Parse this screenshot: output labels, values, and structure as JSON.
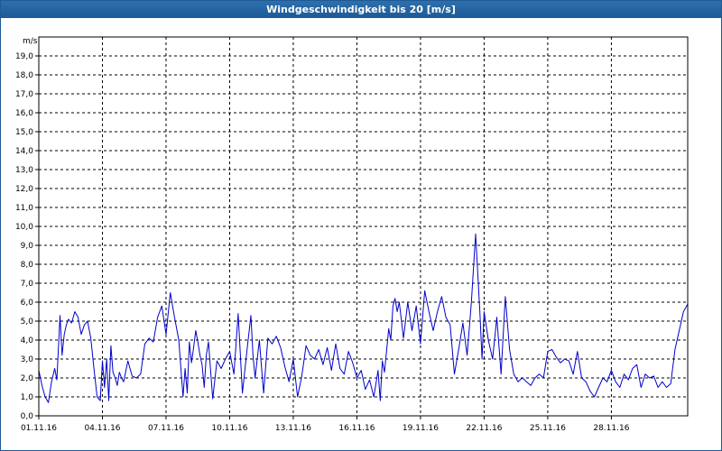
{
  "window": {
    "title": "Windgeschwindigkeit bis 20 [m/s]"
  },
  "chart_data": {
    "type": "line",
    "title": "Windgeschwindigkeit bis 20 [m/s]",
    "ylabel": "m/s",
    "xlabel": "",
    "ylim": [
      0,
      20
    ],
    "yticks": [
      "0,0",
      "1,0",
      "2,0",
      "3,0",
      "4,0",
      "5,0",
      "6,0",
      "7,0",
      "8,0",
      "9,0",
      "10,0",
      "11,0",
      "12,0",
      "13,0",
      "14,0",
      "15,0",
      "16,0",
      "17,0",
      "18,0",
      "19,0"
    ],
    "xticks": [
      "01.11.16",
      "04.11.16",
      "07.11.16",
      "10.11.16",
      "13.11.16",
      "16.11.16",
      "19.11.16",
      "22.11.16",
      "25.11.16",
      "28.11.16"
    ],
    "xlim_days": [
      0,
      30.6
    ],
    "grid": true,
    "line_color": "#0000cc",
    "series": [
      {
        "x": [
          0,
          0.15,
          0.3,
          0.45,
          0.6,
          0.75,
          0.85,
          1.0,
          1.1,
          1.2,
          1.3,
          1.4,
          1.55,
          1.7,
          1.85,
          2.0,
          2.15,
          2.3,
          2.45,
          2.6,
          2.75,
          2.9,
          3.0,
          3.1,
          3.2,
          3.3,
          3.4,
          3.5,
          3.6,
          3.7,
          3.8,
          3.9,
          4.0,
          4.2,
          4.4,
          4.6,
          4.8,
          5.0,
          5.2,
          5.4,
          5.6,
          5.8,
          6.0,
          6.2,
          6.4,
          6.6,
          6.8,
          6.9,
          7.0,
          7.1,
          7.2,
          7.3,
          7.4,
          7.5,
          7.6,
          7.7,
          7.8,
          7.9,
          8.0,
          8.2,
          8.4,
          8.6,
          8.8,
          9.0,
          9.2,
          9.4,
          9.6,
          9.8,
          10.0,
          10.1,
          10.2,
          10.3,
          10.4,
          10.5,
          10.6,
          10.8,
          11.0,
          11.2,
          11.4,
          11.6,
          11.8,
          12.0,
          12.2,
          12.4,
          12.6,
          12.8,
          13.0,
          13.2,
          13.4,
          13.6,
          13.8,
          14.0,
          14.2,
          14.4,
          14.6,
          14.8,
          15.0,
          15.2,
          15.4,
          15.6,
          15.8,
          16.0,
          16.1,
          16.2,
          16.3,
          16.4,
          16.5,
          16.6,
          16.7,
          16.8,
          16.9,
          17.0,
          17.2,
          17.4,
          17.6,
          17.8,
          18.0,
          18.2,
          18.4,
          18.6,
          18.8,
          19.0,
          19.2,
          19.4,
          19.6,
          19.8,
          20.0,
          20.2,
          20.4,
          20.6,
          20.8,
          20.9,
          21.0,
          21.2,
          21.4,
          21.6,
          21.8,
          22.0,
          22.2,
          22.4,
          22.6,
          22.8,
          23.0,
          23.2,
          23.4,
          23.6,
          23.8,
          24.0,
          24.2,
          24.4,
          24.6,
          24.8,
          25.0,
          25.2,
          25.4,
          25.6,
          25.8,
          26.0,
          26.2,
          26.4,
          26.6,
          26.8,
          27.0,
          27.2,
          27.4,
          27.6,
          27.8,
          28.0,
          28.2,
          28.4,
          28.6,
          28.8,
          29.0,
          29.2,
          29.4,
          29.6,
          29.8,
          30.0,
          30.2,
          30.4,
          30.6
        ],
        "y": [
          2.4,
          1.6,
          1.0,
          0.7,
          1.8,
          2.5,
          1.9,
          5.3,
          3.2,
          4.3,
          4.8,
          5.1,
          4.9,
          5.5,
          5.2,
          4.3,
          4.8,
          5.0,
          4.1,
          2.5,
          1.0,
          0.8,
          2.9,
          1.5,
          3.0,
          0.8,
          3.7,
          2.3,
          2.0,
          1.6,
          2.3,
          2.0,
          1.8,
          2.9,
          2.1,
          2.0,
          2.2,
          3.8,
          4.1,
          3.9,
          5.2,
          5.8,
          4.3,
          6.5,
          5.2,
          4.0,
          1.0,
          2.5,
          1.2,
          3.9,
          2.8,
          3.6,
          4.5,
          3.9,
          3.2,
          2.7,
          1.5,
          3.2,
          3.9,
          0.9,
          2.9,
          2.5,
          3.0,
          3.4,
          2.2,
          5.4,
          1.2,
          3.3,
          5.3,
          3.2,
          2.0,
          3.0,
          4.0,
          2.6,
          1.2,
          4.1,
          3.8,
          4.2,
          3.6,
          2.6,
          1.8,
          3.0,
          1.0,
          2.1,
          3.7,
          3.2,
          3.0,
          3.5,
          2.7,
          3.6,
          2.4,
          3.8,
          2.5,
          2.2,
          3.4,
          2.8,
          2.0,
          2.4,
          1.4,
          1.9,
          1.0,
          2.4,
          0.8,
          2.9,
          2.3,
          3.4,
          4.6,
          4.0,
          5.8,
          6.2,
          5.5,
          6.0,
          4.1,
          6.0,
          4.5,
          5.8,
          3.8,
          6.6,
          5.5,
          4.5,
          5.5,
          6.3,
          5.2,
          4.8,
          2.2,
          3.5,
          4.9,
          3.2,
          6.0,
          9.6,
          5.5,
          3.0,
          5.5,
          4.0,
          3.0,
          5.2,
          2.2,
          6.3,
          3.5,
          2.2,
          1.8,
          2.0,
          1.8,
          1.6,
          2.0,
          2.2,
          2.0,
          3.4,
          3.5,
          3.1,
          2.8,
          3.0,
          2.9,
          2.2,
          3.4,
          2.0,
          1.8,
          1.3,
          1.0,
          1.5,
          2.0,
          1.8,
          2.4,
          1.8,
          1.5,
          2.2,
          1.9,
          2.5,
          2.7,
          1.5,
          2.2,
          2.0,
          2.1,
          1.5,
          1.8,
          1.5,
          1.7,
          3.5,
          4.5,
          5.5,
          5.9
        ]
      }
    ]
  }
}
